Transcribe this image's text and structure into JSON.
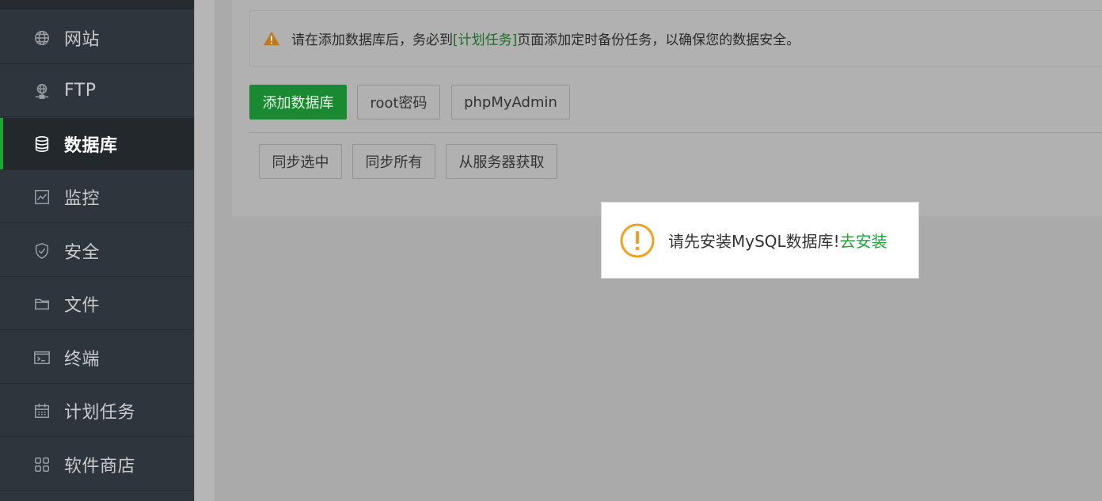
{
  "sidebar": {
    "items": [
      {
        "label": "网站",
        "icon": "globe-icon",
        "active": false
      },
      {
        "label": "FTP",
        "icon": "ftp-network-icon",
        "active": false
      },
      {
        "label": "数据库",
        "icon": "database-icon",
        "active": true
      },
      {
        "label": "监控",
        "icon": "monitor-chart-icon",
        "active": false
      },
      {
        "label": "安全",
        "icon": "shield-icon",
        "active": false
      },
      {
        "label": "文件",
        "icon": "folder-icon",
        "active": false
      },
      {
        "label": "终端",
        "icon": "terminal-icon",
        "active": false
      },
      {
        "label": "计划任务",
        "icon": "calendar-icon",
        "active": false
      },
      {
        "label": "软件商店",
        "icon": "apps-grid-icon",
        "active": false
      }
    ]
  },
  "alert": {
    "icon": "warning-icon",
    "text_before": "请在添加数据库后，务必到",
    "link": "[计划任务]",
    "text_after": "页面添加定时备份任务，以确保您的数据安全。"
  },
  "toolbar": {
    "add_database": "添加数据库",
    "root_password": "root密码",
    "phpmyadmin": "phpMyAdmin"
  },
  "sync_bar": {
    "sync_selected": "同步选中",
    "sync_all": "同步所有",
    "fetch_from_server": "从服务器获取"
  },
  "dialog": {
    "icon": "exclamation-circle-icon",
    "message": "请先安装MySQL数据库!",
    "link": "去安装"
  },
  "colors": {
    "accent": "#20a53a",
    "warning": "#f0a020",
    "sidebar_bg": "#2f353c"
  }
}
